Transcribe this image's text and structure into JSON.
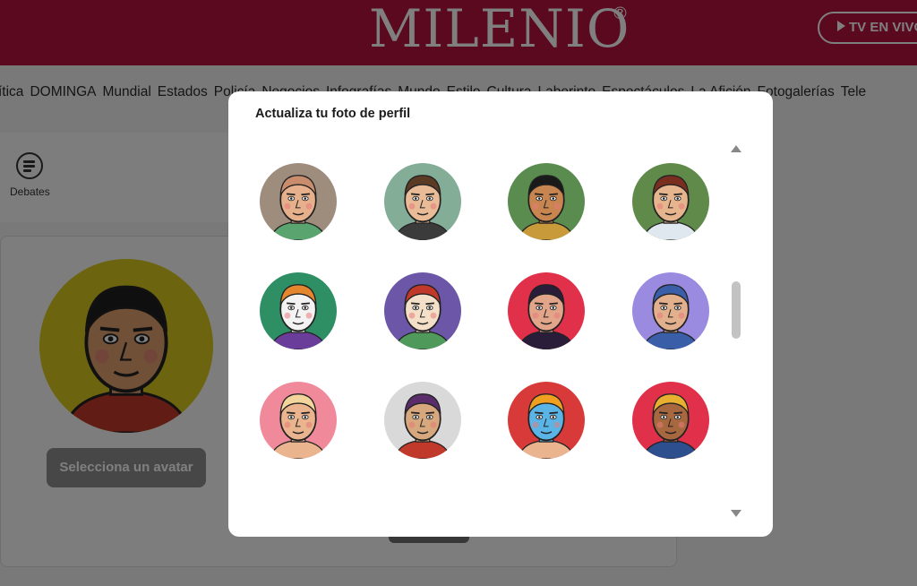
{
  "header": {
    "brand": "MILENIO",
    "brand_mark": "®",
    "tv_label": "TV EN VIVO",
    "bg_color": "#b5123d"
  },
  "nav": {
    "items": [
      "ítica",
      "DOMINGA",
      "Mundial",
      "Estados",
      "Policía",
      "Negocios",
      "Infografías",
      "Mundo",
      "Estilo",
      "Cultura",
      "Laberinto",
      "Espectáculos",
      "La Afición",
      "Fotogalerías",
      "Tele"
    ]
  },
  "sidebar": {
    "debates_label": "Debates",
    "debates_icon": "chat-lines-icon"
  },
  "profile": {
    "select_label": "Selecciona un avatar"
  },
  "modal": {
    "title": "Actualiza tu foto de perfil",
    "scroll_up_icon": "chevron-up",
    "scroll_down_icon": "chevron-down"
  },
  "avatars": [
    {
      "bg": "#bfe3cf",
      "skin": "#6b4a32",
      "hair": "#2a1d12",
      "shirt": "#3c6e3c"
    },
    {
      "bg": "#5ec3c4",
      "skin": "#e7b48d",
      "hair": "#6b4a2b",
      "shirt": "#c0392b"
    },
    {
      "bg": "#bdbdbd",
      "skin": "#d9a36f",
      "hair": "#3a2a1e",
      "shirt": "#2d4f8e"
    },
    {
      "bg": "#e8503a",
      "skin": "#efc7a0",
      "hair": "#3a2a1e",
      "shirt": "#ffffff"
    },
    {
      "bg": "#9e8c7d",
      "skin": "#e7b08c",
      "hair": "#c98c6c",
      "shirt": "#5aa56f"
    },
    {
      "bg": "#84ad98",
      "skin": "#e9bb97",
      "hair": "#5c3b24",
      "shirt": "#3b3b3b"
    },
    {
      "bg": "#5a8b4f",
      "skin": "#c8854f",
      "hair": "#1a1a1a",
      "shirt": "#c89a3a"
    },
    {
      "bg": "#5f8a4a",
      "skin": "#e6b58e",
      "hair": "#7a2e1f",
      "shirt": "#dfe8ee"
    },
    {
      "bg": "#2f8f64",
      "skin": "#f3f3f3",
      "hair": "#e3862e",
      "shirt": "#6a3d9a"
    },
    {
      "bg": "#6b56a8",
      "skin": "#f4e0c8",
      "hair": "#c0392b",
      "shirt": "#4f9a5a"
    },
    {
      "bg": "#e0304a",
      "skin": "#e2a58a",
      "hair": "#2a1d3a",
      "shirt": "#2a1d3a"
    },
    {
      "bg": "#9a8ae0",
      "skin": "#e2b08c",
      "hair": "#3a5fa8",
      "shirt": "#3a5fa8"
    },
    {
      "bg": "#f08a9a",
      "skin": "#e9b48e",
      "hair": "#f1d59a",
      "shirt": "#e9b48e"
    },
    {
      "bg": "#d9d9d9",
      "skin": "#d7a77e",
      "hair": "#5a2d6a",
      "shirt": "#c0392b"
    },
    {
      "bg": "#d83a3a",
      "skin": "#5ab5e6",
      "hair": "#f0a020",
      "shirt": "#e9b48e"
    },
    {
      "bg": "#e0304a",
      "skin": "#a8683f",
      "hair": "#e8b030",
      "shirt": "#2d4f8e"
    }
  ],
  "profile_avatar": {
    "bg": "#d9c91c",
    "skin": "#e2a070",
    "hair": "#1e1e1e",
    "shirt": "#c0392b"
  }
}
